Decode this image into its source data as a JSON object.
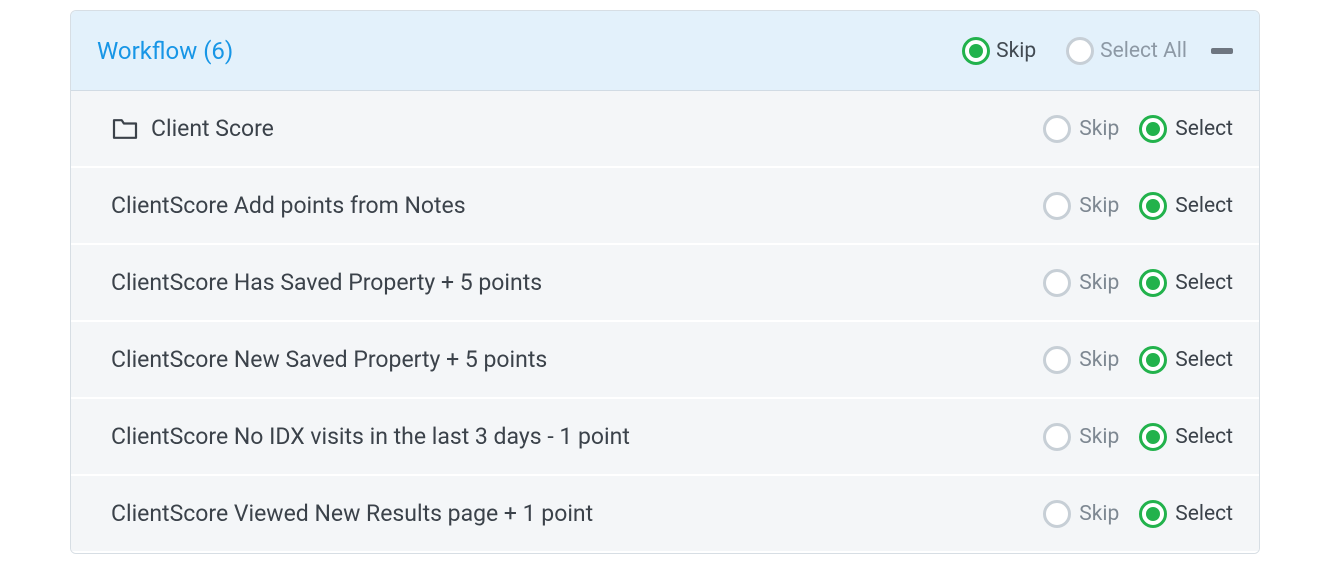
{
  "header": {
    "title": "Workflow (6)",
    "skip_label": "Skip",
    "select_all_label": "Select All"
  },
  "labels": {
    "skip": "Skip",
    "select": "Select"
  },
  "items": [
    {
      "name": "Client Score",
      "has_folder": true
    },
    {
      "name": "ClientScore Add points from Notes",
      "has_folder": false
    },
    {
      "name": "ClientScore Has Saved Property + 5 points",
      "has_folder": false
    },
    {
      "name": "ClientScore New Saved Property + 5 points",
      "has_folder": false
    },
    {
      "name": "ClientScore No IDX visits in the last 3 days - 1 point",
      "has_folder": false
    },
    {
      "name": "ClientScore Viewed New Results page + 1 point",
      "has_folder": false
    }
  ]
}
